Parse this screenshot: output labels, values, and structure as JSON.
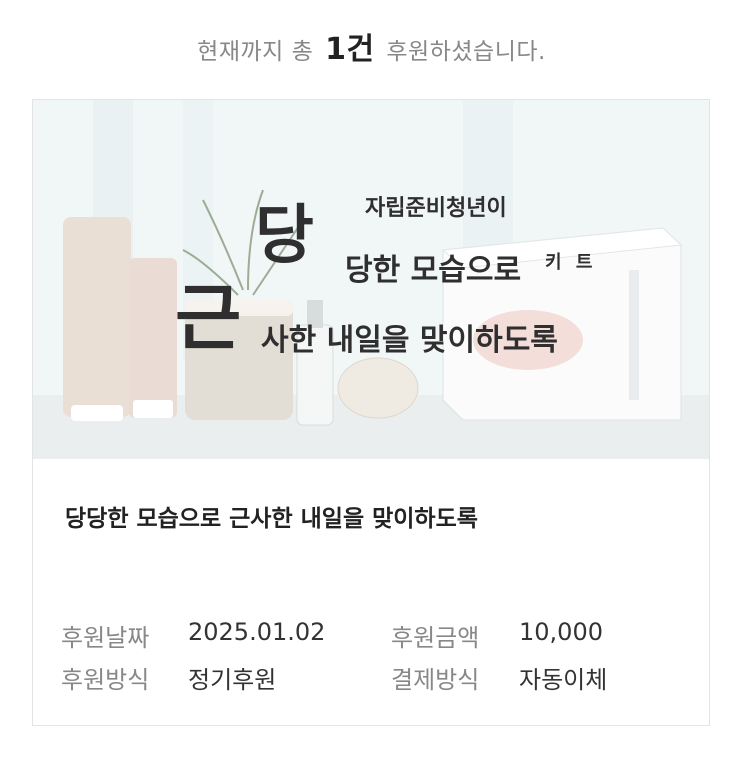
{
  "summary": {
    "prefix": "현재까지 총",
    "count": "1건",
    "suffix": "후원하셨습니다."
  },
  "campaign": {
    "banner": {
      "subtitle": "자립준비청년이",
      "big_char_1": "당",
      "line_1": "당한 모습으로",
      "big_char_2": "근",
      "line_2": "사한 내일을 맞이하도록",
      "kit_text": "키 트"
    },
    "title": "당당한 모습으로 근사한 내일을 맞이하도록",
    "details": {
      "date_label": "후원날짜",
      "date_value": "2025.01.02",
      "amount_label": "후원금액",
      "amount_value": "10,000",
      "type_label": "후원방식",
      "type_value": "정기후원",
      "payment_label": "결제방식",
      "payment_value": "자동이체"
    }
  }
}
